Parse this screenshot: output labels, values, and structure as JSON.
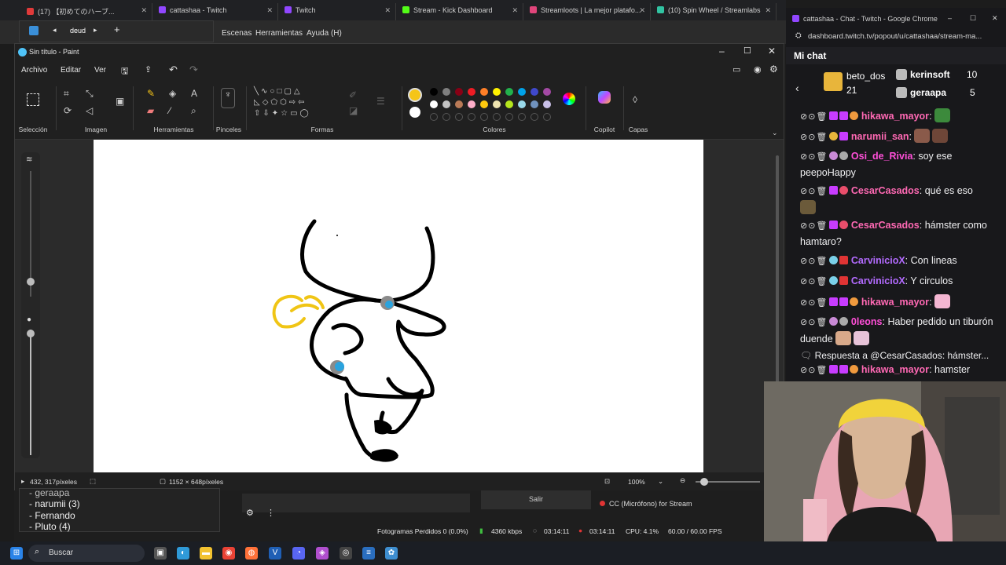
{
  "browser_tabs": [
    {
      "label": "(17) 【初めてのハーブ...",
      "color": "#e03a3a"
    },
    {
      "label": "cattashaa - Twitch",
      "color": "#9147ff"
    },
    {
      "label": "Twitch",
      "color": "#9147ff"
    },
    {
      "label": "Stream - Kick Dashboard",
      "color": "#53fc18"
    },
    {
      "label": "Streamloots | La mejor platafo...",
      "color": "#e0457b"
    },
    {
      "label": "(10) Spin Wheel / Streamlabs",
      "color": "#31c3a2"
    }
  ],
  "obs_menu": {
    "escenas": "Escenas",
    "herramientas": "Herramientas",
    "ayuda": "Ayuda (H)"
  },
  "mini_window": {
    "text": "deud"
  },
  "paint": {
    "title": "Sin título - Paint",
    "menu": [
      "Archivo",
      "Editar",
      "Ver"
    ],
    "groups": {
      "seleccion": "Selección",
      "imagen": "Imagen",
      "herramientas": "Herramientas",
      "pinceles": "Pinceles",
      "formas": "Formas",
      "colores": "Colores",
      "copilot": "Copilot",
      "capas": "Capas"
    },
    "palette": [
      "#000000",
      "#7f7f7f",
      "#880015",
      "#ed1c24",
      "#ff7f27",
      "#fff200",
      "#22b14c",
      "#00a2e8",
      "#3f48cc",
      "#a349a4",
      "#ffffff",
      "#c3c3c3",
      "#b97a57",
      "#ffaec9",
      "#ffc90e",
      "#efe4b0",
      "#b5e61d",
      "#99d9ea",
      "#7092be",
      "#c8bfe7"
    ],
    "primary_color": "#f5c518",
    "secondary_color": "#ffffff",
    "status": {
      "cursor": "432, 317píxeles",
      "size": "1152 × 648píxeles",
      "zoom": "100%"
    }
  },
  "obs": {
    "list": [
      "- geraapa",
      "- narumii (3)",
      "- Fernando",
      "- Pluto (4)"
    ],
    "salir": "Salir",
    "mic": "CC (Micrófono) for Stream",
    "stats": {
      "dropped": "Fotogramas Perdidos 0 (0.0%)",
      "kbps": "4360 kbps",
      "time1": "03:14:11",
      "time2": "03:14:11",
      "cpu": "CPU: 4.1%",
      "fps": "60.00 / 60.00 FPS"
    }
  },
  "taskbar": {
    "search": "Buscar"
  },
  "chat": {
    "window_title": "cattashaa - Chat - Twitch - Google Chrome",
    "url": "dashboard.twitch.tv/popout/u/cattashaa/stream-ma...",
    "header": "Mi chat",
    "leaderboard": [
      {
        "name": "beto_dos",
        "count": "21"
      },
      {
        "name": "kerinsoft",
        "count": "10"
      },
      {
        "name": "geraapa",
        "count": "5"
      }
    ],
    "messages": [
      {
        "user": "hikawa_mayor",
        "color": "#ff69b4",
        "text": ":"
      },
      {
        "user": "narumii_san",
        "color": "#ff69b4",
        "text": ":"
      },
      {
        "user": "Osi_de_Rivia",
        "color": "#ff4fd8",
        "text": ": soy ese peepoHappy"
      },
      {
        "user": "CesarCasados",
        "color": "#ff69b4",
        "text": ": qué es eso"
      },
      {
        "user": "CesarCasados",
        "color": "#ff69b4",
        "text": ": hámster como hamtaro?"
      },
      {
        "user": "CarvinicioX",
        "color": "#b36bff",
        "text": ": Con lineas"
      },
      {
        "user": "CarvinicioX",
        "color": "#b36bff",
        "text": ": Y circulos"
      },
      {
        "user": "hikawa_mayor",
        "color": "#ff69b4",
        "text": ":"
      },
      {
        "user": "0leons",
        "color": "#ff4fd8",
        "text": ": Haber pedido un tiburón duende"
      },
      {
        "reply": "Respuesta a @CesarCasados: hámster..."
      },
      {
        "user": "hikawa_mayor",
        "color": "#ff69b4",
        "text": ": hamster"
      }
    ]
  }
}
